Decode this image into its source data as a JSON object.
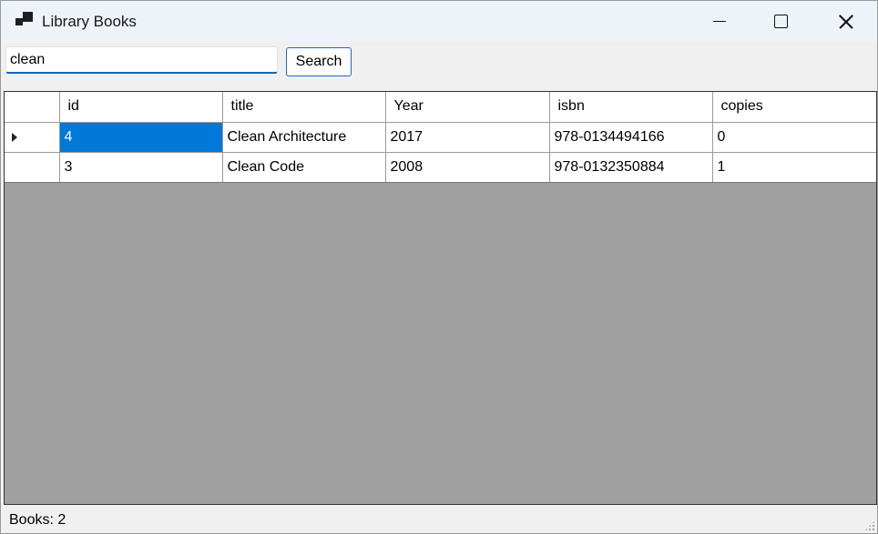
{
  "window": {
    "title": "Library Books",
    "icon": "app-window-icon",
    "controls": {
      "minimize": "minimize-icon",
      "maximize": "maximize-icon",
      "close": "close-icon"
    }
  },
  "search": {
    "value": "clean",
    "button_label": "Search"
  },
  "grid": {
    "columns": [
      "id",
      "title",
      "Year",
      "isbn",
      "copies"
    ],
    "rows": [
      {
        "id": "4",
        "title": "Clean Architecture",
        "year": "2017",
        "isbn": "978-0134494166",
        "copies": "0",
        "current": true,
        "selected_cell": "id"
      },
      {
        "id": "3",
        "title": "Clean Code",
        "year": "2008",
        "isbn": "978-0132350884",
        "copies": "1",
        "current": false
      }
    ],
    "colors": {
      "selection": "#0078d7",
      "empty_area": "#a0a0a0"
    }
  },
  "status": {
    "text": "Books: 2"
  }
}
